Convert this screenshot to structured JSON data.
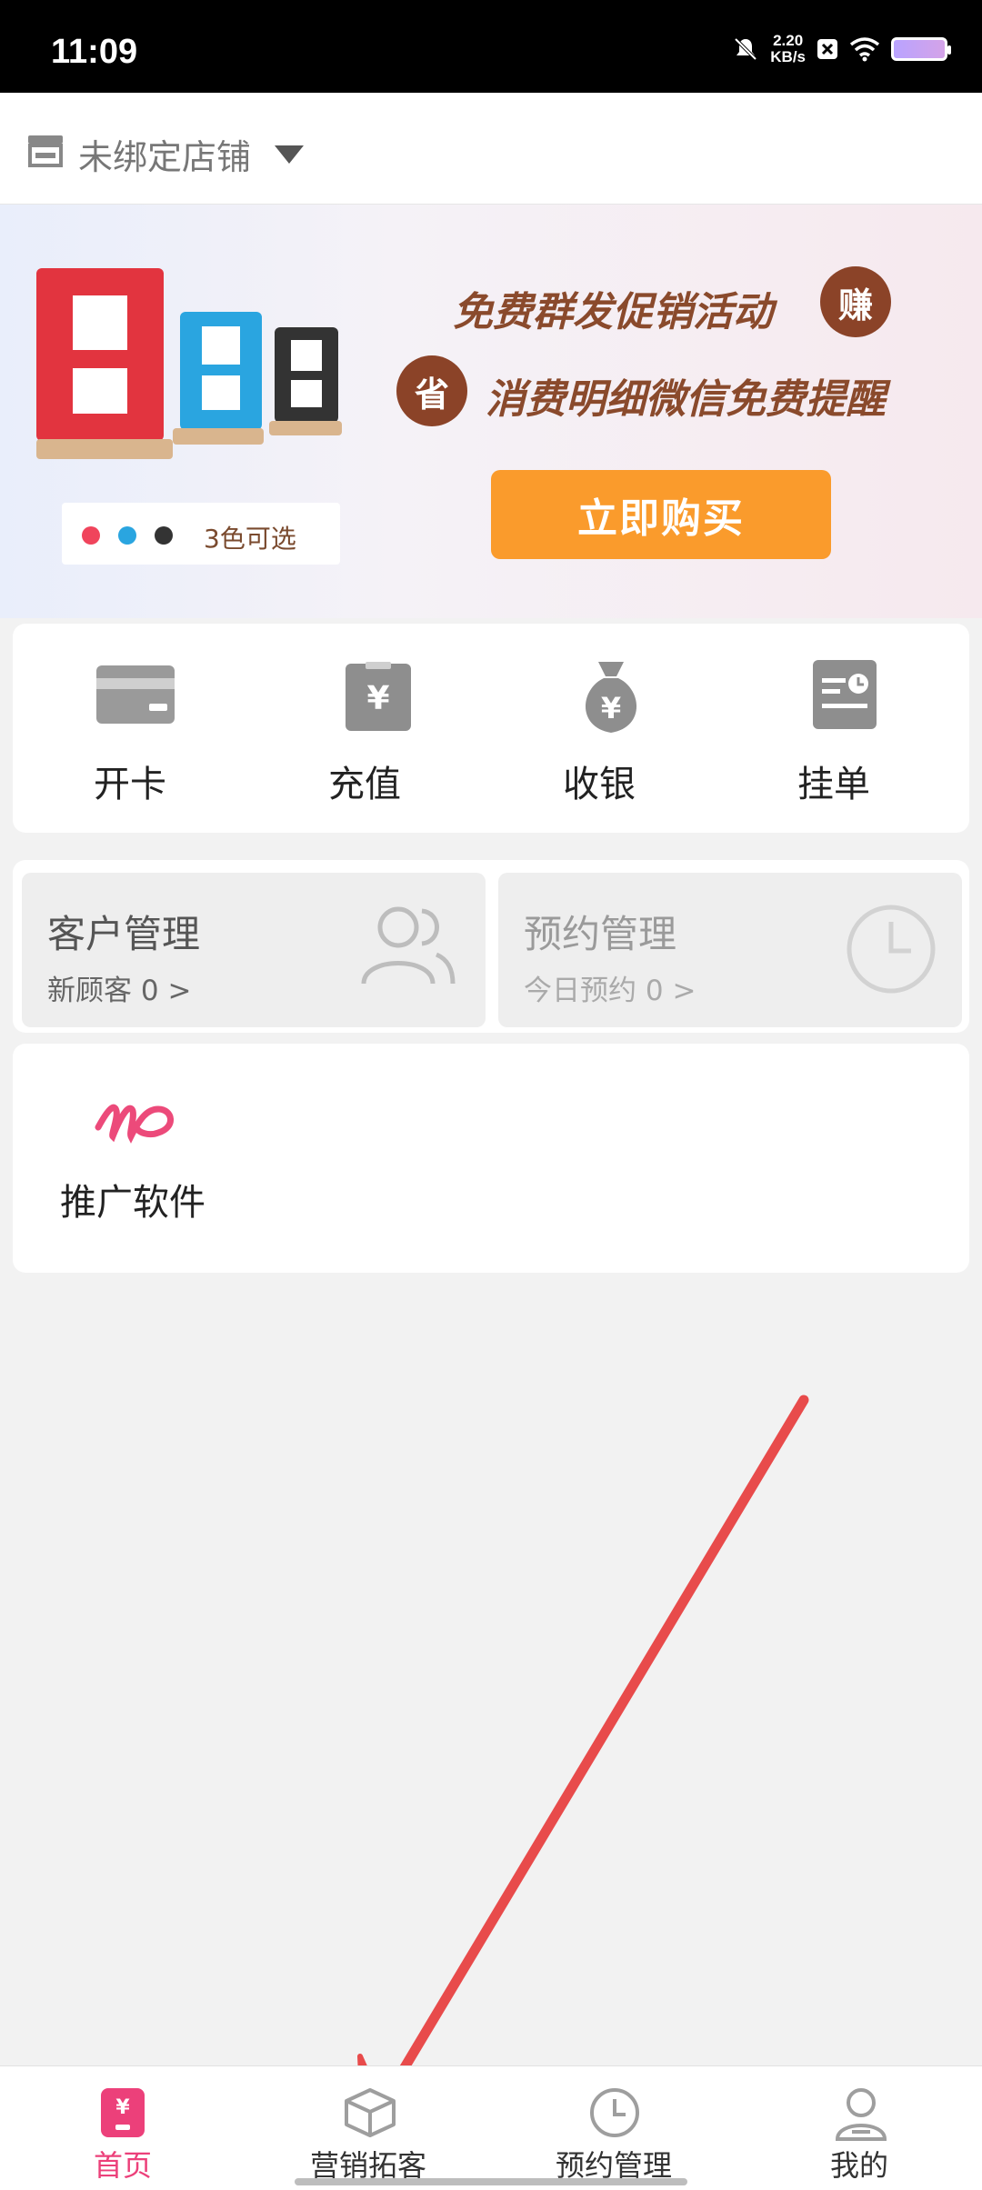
{
  "status_bar": {
    "time": "11:09",
    "net_speed_value": "2.20",
    "net_speed_unit": "KB/s"
  },
  "header": {
    "store_name": "未绑定店铺",
    "icon": "shop-icon"
  },
  "banner": {
    "color_options_label": "3色可选",
    "color_dots": [
      "#f0445c",
      "#2aa5e0",
      "#333333"
    ],
    "promo_line1": "免费群发促销活动",
    "promo_line1_badge": "赚",
    "promo_line2": "消费明细微信免费提醒",
    "promo_line2_badge": "省",
    "buy_button": "立即购买",
    "accent": "#fa9b2c",
    "text_color": "#8a4a2c"
  },
  "quick_actions": [
    {
      "label": "开卡",
      "icon": "card-icon"
    },
    {
      "label": "充值",
      "icon": "yuan-recharge-icon"
    },
    {
      "label": "收银",
      "icon": "money-bag-icon"
    },
    {
      "label": "挂单",
      "icon": "pending-order-icon"
    }
  ],
  "management": {
    "customer": {
      "title": "客户管理",
      "sub_label": "新顾客",
      "count": "0",
      "chevron": ">",
      "icon": "users-icon"
    },
    "booking": {
      "title": "预约管理",
      "sub_label": "今日预约",
      "count": "0",
      "chevron": ">",
      "icon": "clock-icon"
    }
  },
  "promo_software": {
    "label": "推广软件",
    "icon": "md-logo-icon"
  },
  "bottom_nav": [
    {
      "label": "首页",
      "icon": "home-phone-icon",
      "active": true
    },
    {
      "label": "营销拓客",
      "icon": "box-icon",
      "active": false
    },
    {
      "label": "预约管理",
      "icon": "clock-icon",
      "active": false
    },
    {
      "label": "我的",
      "icon": "user-icon",
      "active": false
    }
  ],
  "colors": {
    "active_tab": "#ec407a",
    "annotation_arrow": "#e84b4b"
  }
}
